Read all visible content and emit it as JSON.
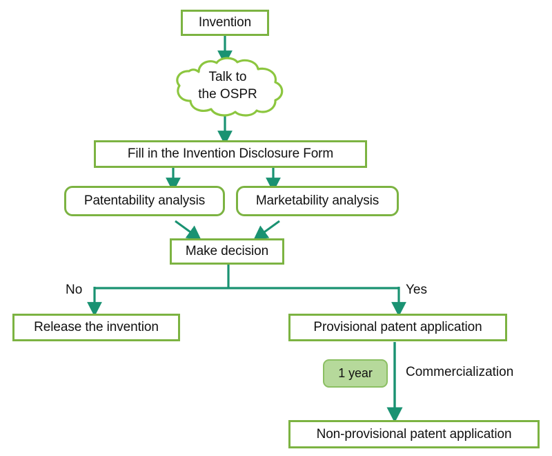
{
  "diagram": {
    "title": "Invention to patent process flowchart",
    "colors": {
      "box_border": "#7cb342",
      "arrow": "#1a9272",
      "cloud_stroke": "#8cc63f",
      "pill_fill": "#b6d99b",
      "pill_border": "#8bbf62",
      "text": "#111111",
      "background": "#ffffff"
    },
    "nodes": [
      {
        "id": "invention",
        "label": "Invention",
        "shape": "rect"
      },
      {
        "id": "talk_ospr",
        "label_line1": "Talk to",
        "label_line2": "the OSPR",
        "shape": "cloud"
      },
      {
        "id": "disclosure_form",
        "label": "Fill in the Invention Disclosure Form",
        "shape": "rect"
      },
      {
        "id": "patentability",
        "label": "Patentability analysis",
        "shape": "rounded-rect"
      },
      {
        "id": "marketability",
        "label": "Marketability analysis",
        "shape": "rounded-rect"
      },
      {
        "id": "make_decision",
        "label": "Make decision",
        "shape": "rect"
      },
      {
        "id": "release",
        "label": "Release the invention",
        "shape": "rect"
      },
      {
        "id": "provisional",
        "label": "Provisional patent application",
        "shape": "rect"
      },
      {
        "id": "one_year",
        "label": "1 year",
        "shape": "pill"
      },
      {
        "id": "non_provisional",
        "label": "Non-provisional patent application",
        "shape": "rect"
      }
    ],
    "edge_labels": {
      "no": "No",
      "yes": "Yes",
      "commercialization": "Commercialization"
    }
  }
}
